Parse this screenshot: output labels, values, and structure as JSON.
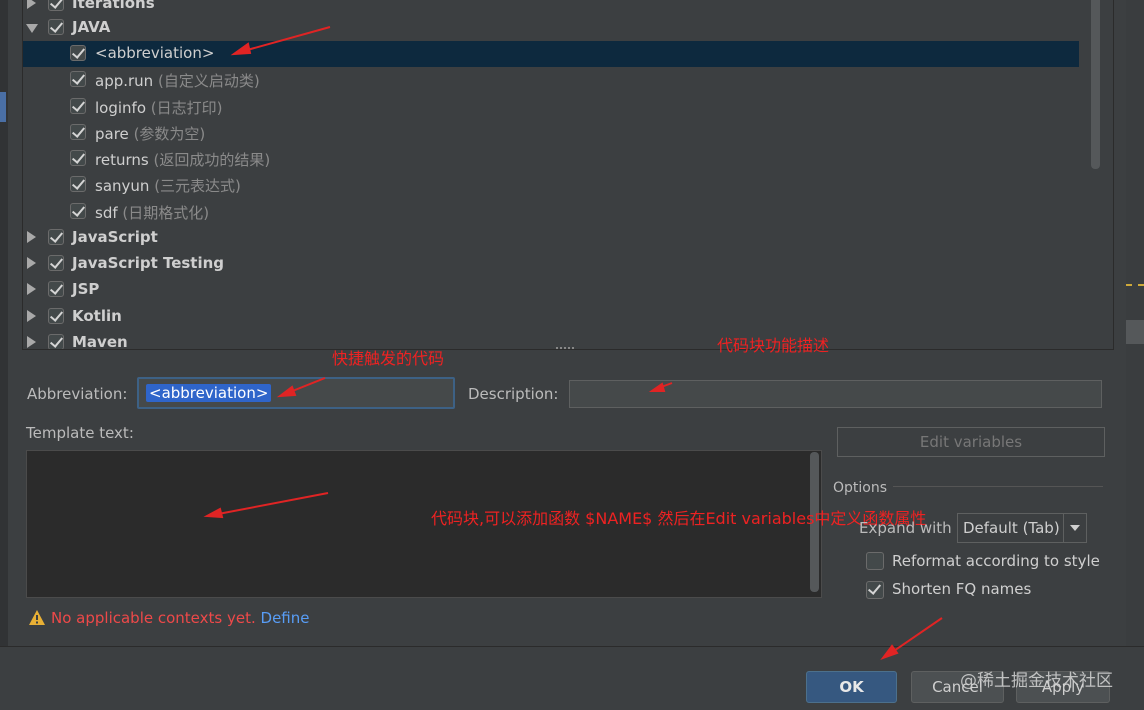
{
  "tree": {
    "groups": [
      {
        "label": "Iterations",
        "expanded": false,
        "checked": true
      },
      {
        "label": "JAVA",
        "expanded": true,
        "checked": true
      },
      {
        "label": "JavaScript",
        "expanded": false,
        "checked": true
      },
      {
        "label": "JavaScript Testing",
        "expanded": false,
        "checked": true
      },
      {
        "label": "JSP",
        "expanded": false,
        "checked": true
      },
      {
        "label": "Kotlin",
        "expanded": false,
        "checked": true
      },
      {
        "label": "Maven",
        "expanded": false,
        "checked": true
      }
    ],
    "java_items": [
      {
        "name": "<abbreviation>",
        "desc": "",
        "checked": true,
        "selected": true
      },
      {
        "name": "app.run",
        "desc": "(自定义启动类)",
        "checked": true
      },
      {
        "name": "loginfo",
        "desc": "(日志打印)",
        "checked": true
      },
      {
        "name": "pare",
        "desc": "(参数为空)",
        "checked": true
      },
      {
        "name": "returns",
        "desc": "(返回成功的结果)",
        "checked": true
      },
      {
        "name": "sanyun",
        "desc": "(三元表达式)",
        "checked": true
      },
      {
        "name": "sdf",
        "desc": "(日期格式化)",
        "checked": true
      }
    ]
  },
  "form": {
    "abbreviation_label": "Abbreviation:",
    "abbreviation_value": "<abbreviation>",
    "description_label": "Description:",
    "description_value": "",
    "template_label": "Template text:",
    "template_value": "",
    "edit_variables_label": "Edit variables"
  },
  "options": {
    "title": "Options",
    "expand_with_label": "Expand with",
    "expand_with_value": "Default (Tab)",
    "reformat_label": "Reformat according to style",
    "reformat_checked": false,
    "shorten_label": "Shorten FQ names",
    "shorten_checked": true
  },
  "warning": {
    "text": "No applicable contexts yet.",
    "link": "Define"
  },
  "buttons": {
    "ok": "OK",
    "cancel": "Cancel",
    "apply": "Apply"
  },
  "annotations": {
    "shortcut_note": "快捷触发的代码",
    "desc_note": "代码块功能描述",
    "template_note": "代码块,可以添加函数 $NAME$ 然后在Edit variables中定义函数属性"
  },
  "watermark": "@稀土掘金技术社区",
  "colors": {
    "selection": "#0d293e",
    "annotation_red": "#ee2222",
    "ok_button": "#365880",
    "warning_text": "#ee4949",
    "link": "#589df6"
  }
}
